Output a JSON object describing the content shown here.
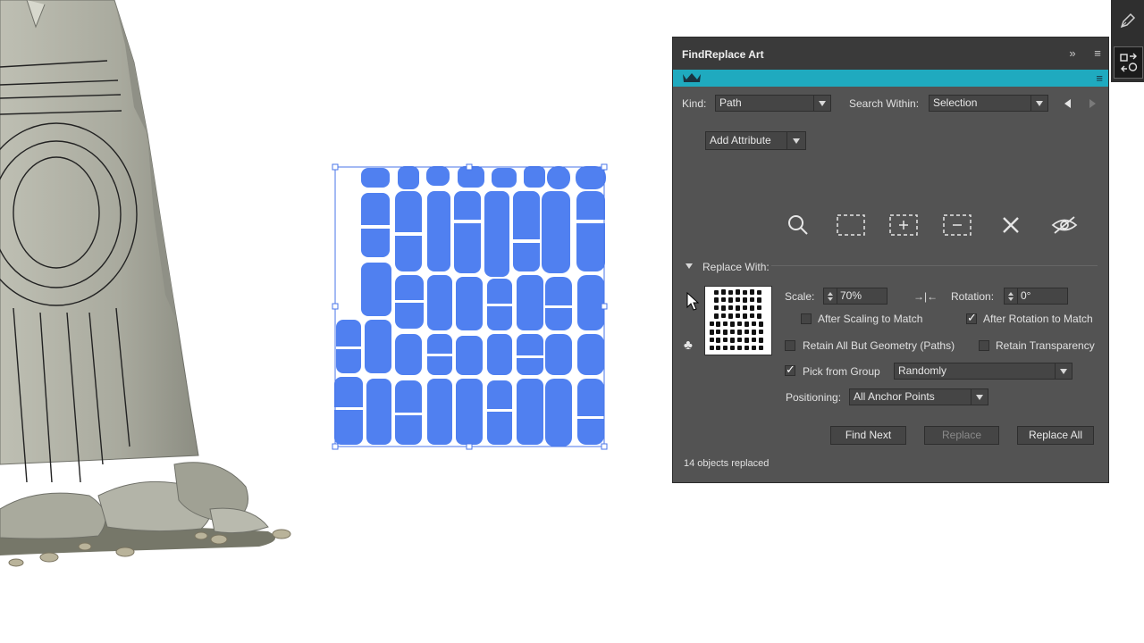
{
  "panel": {
    "title": "FindReplace Art",
    "kind_label": "Kind:",
    "kind_value": "Path",
    "search_within_label": "Search Within:",
    "search_within_value": "Selection",
    "add_attribute_label": "Add Attribute",
    "replace_with_label": "Replace With:",
    "scale_label": "Scale:",
    "scale_value": "70%",
    "rotation_label": "Rotation:",
    "rotation_value": "0°",
    "after_scaling_label": "After Scaling to Match",
    "after_scaling_checked": false,
    "after_rotation_label": "After Rotation to Match",
    "after_rotation_checked": true,
    "retain_all_label": "Retain All But Geometry (Paths)",
    "retain_all_checked": false,
    "retain_transparency_label": "Retain Transparency",
    "retain_transparency_checked": false,
    "pick_from_group_label": "Pick from Group",
    "pick_from_group_checked": true,
    "pick_mode_value": "Randomly",
    "positioning_label": "Positioning:",
    "positioning_value": "All Anchor Points",
    "find_next_label": "Find Next",
    "replace_label": "Replace",
    "replace_all_label": "Replace All",
    "status_text": "14 objects replaced"
  },
  "colors": {
    "panel_bg": "#535353",
    "panel_header": "#3a3a3a",
    "accent_bar": "#1faabf",
    "selection_fill": "#5080f0",
    "stone": "#a7a89b"
  },
  "icons": [
    "search-icon",
    "select-all-icon",
    "add-to-selection-icon",
    "subtract-from-selection-icon",
    "close-icon",
    "hide-icon",
    "crown-icon",
    "club-icon",
    "pen-tool-icon",
    "find-replace-icon"
  ]
}
